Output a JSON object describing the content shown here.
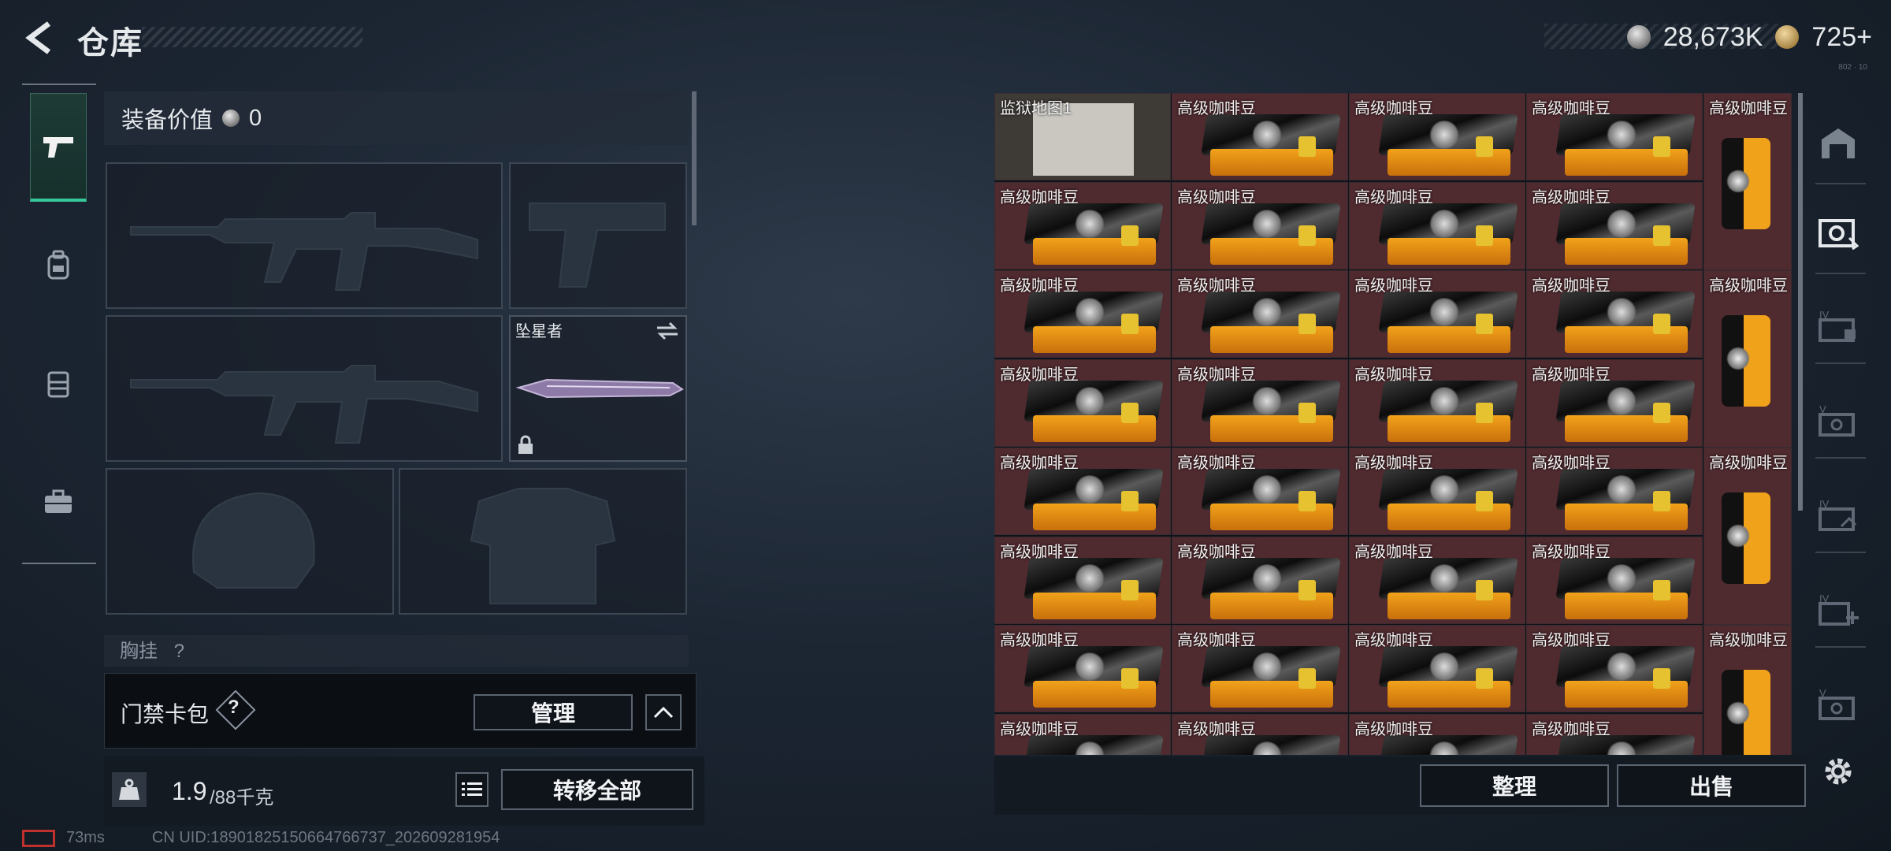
{
  "header": {
    "title": "仓库",
    "silver_amount": "28,673K",
    "gold_amount": "725+",
    "tiny_corner": "802 · 10"
  },
  "equipment": {
    "value_label": "装备价值",
    "value_amount": "0",
    "melee_name": "坠星者",
    "chest_label": "胸挂",
    "chest_hint": "?",
    "keycard_label": "门禁卡包",
    "keycard_help": "?",
    "manage_label": "管理",
    "weight_current": "1.9",
    "weight_max": "/88千克",
    "transfer_all_label": "转移全部"
  },
  "inventory": {
    "map_item": "监狱地图1",
    "coffee_item": "高级咖啡豆",
    "sort_label": "整理",
    "sell_label": "出售"
  },
  "status": {
    "ping": "73ms",
    "uid": "CN UID:18901825150664766737_202609281954"
  },
  "colors": {
    "accent_green": "#38c79a",
    "item_cell": "#4f2a2f"
  }
}
